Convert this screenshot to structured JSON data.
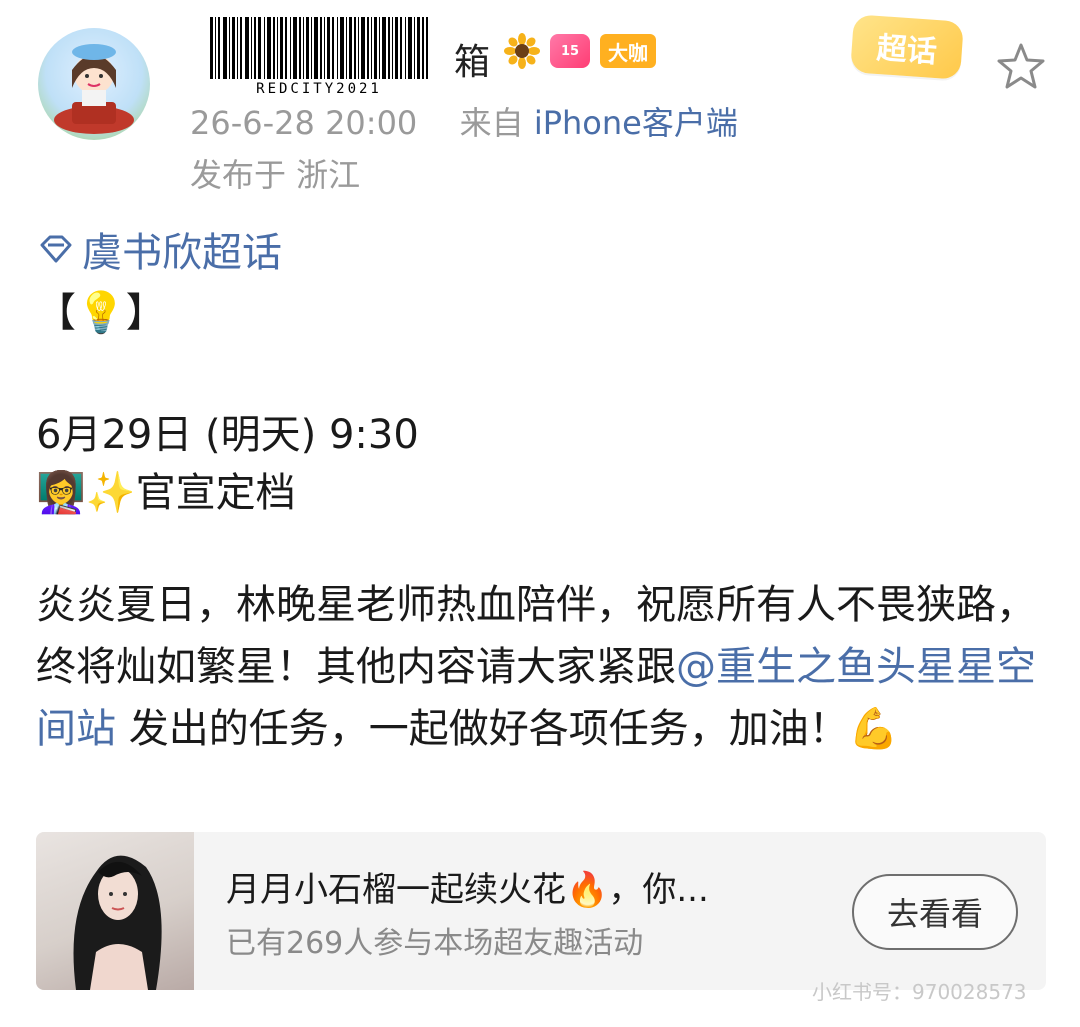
{
  "header": {
    "username": "箱",
    "barcode_text": "REDCITY2021",
    "vip_badge": "15",
    "daka_badge": "大咖",
    "datetime": "26-6-28 20:00",
    "from_prefix": "来自",
    "source": "iPhone客户端",
    "location": "发布于 浙江",
    "chaohua_badge": "超话"
  },
  "post": {
    "topic": "虞书欣超话",
    "bracket_line": "【💡】",
    "date_line": "6月29日 (明天) 9:30",
    "announce_line": "👩‍🏫✨官宣定档",
    "para_before": "炎炎夏日，林晚星老师热血陪伴，祝愿所有人不畏狭路，终将灿如繁星！其他内容请大家紧跟",
    "mention": "@重生之鱼头星星空间站",
    "para_after": " 发出的任务，一起做好各项任务，加油！💪"
  },
  "card": {
    "title": "月月小石榴一起续火花🔥，你...",
    "subtitle": "已有269人参与本场超友趣活动",
    "button": "去看看"
  },
  "watermark": "小红书号：970028573",
  "colors": {
    "link": "#4a6ea8",
    "meta": "#9a9a9a",
    "daka_badge": "#ffb020",
    "vip_badge": "#ff3d74"
  },
  "icons": [
    "sunflower-icon",
    "vip-gem-icon",
    "topic-diamond-icon",
    "star-icon",
    "chaohua-badge-icon"
  ]
}
